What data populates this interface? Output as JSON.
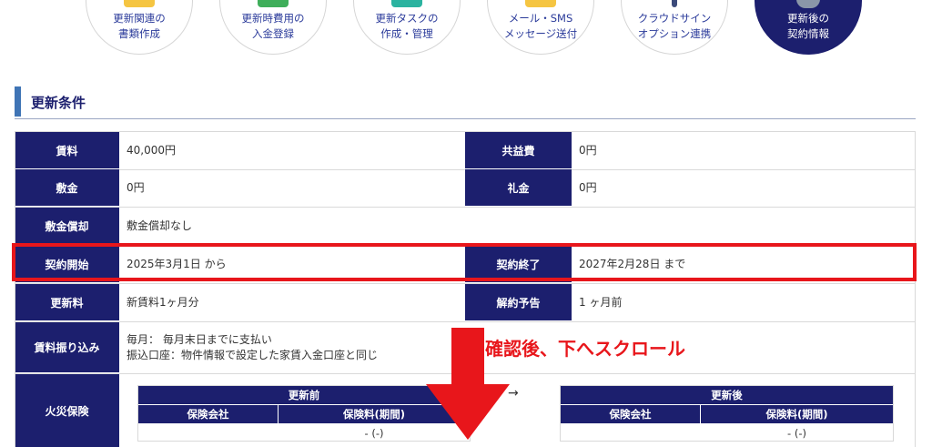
{
  "steps": [
    {
      "label1": "更新関連の",
      "label2": "書類作成",
      "accent": "#f5c542",
      "active": false
    },
    {
      "label1": "更新時費用の",
      "label2": "入金登録",
      "accent": "#3fae5a",
      "active": false
    },
    {
      "label1": "更新タスクの",
      "label2": "作成・管理",
      "accent": "#2bb3a0",
      "active": false
    },
    {
      "label1": "メール・SMS",
      "label2": "メッセージ送付",
      "accent": "#f5c542",
      "active": false
    },
    {
      "label1": "クラウドサイン",
      "label2": "オプション連携",
      "accent": "#3b4a7a",
      "active": false
    },
    {
      "label1": "更新後の",
      "label2": "契約情報",
      "accent": "#8a96a8",
      "active": true
    }
  ],
  "section": {
    "title": "更新条件"
  },
  "rows": {
    "rent": {
      "label": "賃料",
      "value": "40,000円"
    },
    "common_fee": {
      "label": "共益費",
      "value": "0円"
    },
    "deposit": {
      "label": "敷金",
      "value": "0円"
    },
    "key_money": {
      "label": "礼金",
      "value": "0円"
    },
    "deposit_amort": {
      "label": "敷金償却",
      "value": "敷金償却なし"
    },
    "contract_start": {
      "label": "契約開始",
      "value": "2025年3月1日 から"
    },
    "contract_end": {
      "label": "契約終了",
      "value": "2027年2月28日 まで"
    },
    "renewal_fee": {
      "label": "更新料",
      "value": "新賃料1ヶ月分"
    },
    "cancel_notice": {
      "label": "解約予告",
      "value": "1 ヶ月前"
    },
    "rent_transfer": {
      "label": "賃料振り込み",
      "line1": "毎月： 毎月末日までに支払い",
      "line2": "振込口座：物件情報で設定した家賃入金口座と同じ"
    },
    "fire_insurance": {
      "label": "火災保険"
    }
  },
  "insurance": {
    "before": {
      "title": "更新前",
      "col1": "保険会社",
      "col2": "保険料(期間)",
      "value": "- (-)"
    },
    "after": {
      "title": "更新後",
      "col1": "保険会社",
      "col2": "保険料(期間)",
      "value": "- (-)"
    },
    "arrow": "→"
  },
  "annotation": {
    "text": "確認後、下へスクロール",
    "color": "#e8161b"
  },
  "colors": {
    "header_bg": "#1c1f6e",
    "highlight": "#e8161b",
    "section_bar": "#3f74b5"
  }
}
